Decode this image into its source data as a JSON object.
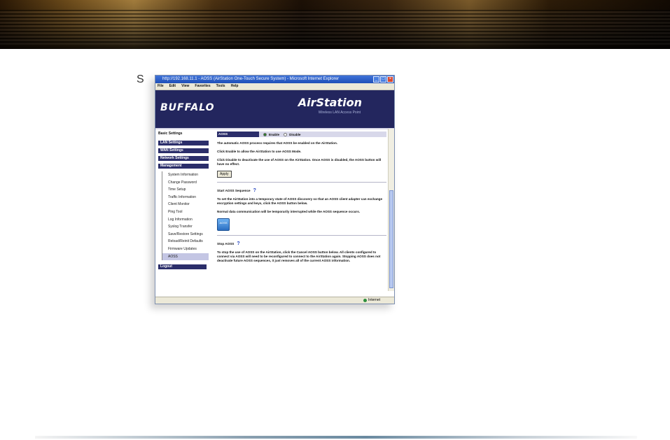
{
  "page": {
    "stray_glyph": "S"
  },
  "browser": {
    "title": "http://192.168.11.1 - AOSS (AirStation One-Touch Secure System) - Microsoft Internet Explorer",
    "menu": [
      "File",
      "Edit",
      "View",
      "Favorites",
      "Tools",
      "Help"
    ],
    "status": "Internet"
  },
  "header": {
    "brand": "BUFFALO",
    "product": "AirStation",
    "product_sub": "Wireless LAN Access Point"
  },
  "nav": {
    "basic": "Basic Settings",
    "sections": [
      "LAN Settings",
      "WAN Settings",
      "Network Settings",
      "Management"
    ],
    "management_items": [
      "System Information",
      "Change Password",
      "Time Setup",
      "Traffic Information",
      "Client Monitor",
      "Ping Tool",
      "Log Information",
      "Syslog Transfer",
      "Save/Restore Settings",
      "Reload/Reinit Defaults",
      "Firmware Updates",
      "AOSS"
    ],
    "logout": "Logout"
  },
  "content": {
    "aoss_label": "AOSS",
    "enable": "Enable",
    "disable": "Disable",
    "p1": "The automatic AOSS process requires that AOSS be enabled on the AirStation.",
    "p2": "Click Enable to allow the AirStation to use AOSS Mode.",
    "p3": "Click Disable to deactivate the use of AOSS on the AirStation. Once AOSS is disabled, the AOSS button will have no effect.",
    "apply": "Apply",
    "start_title": "Start AOSS Sequence",
    "start_p1": "To set the AirStation into a temporary state of AOSS discovery so that an AOSS client adapter can exchange encryption settings and keys, click the AOSS button below.",
    "start_p2": "Normal data communication will be temporarily interrupted while the AOSS sequence occurs.",
    "aoss_button": "AOSS",
    "stop_title": "Stop AOSS",
    "stop_p": "To stop the use of AOSS on the AirStation, click the Cancel AOSS button below. All clients configured to connect via AOSS will need to be reconfigured to connect to the AirStation again. Stopping AOSS does not deactivate future AOSS sequences, it just removes all of the current AOSS information."
  }
}
